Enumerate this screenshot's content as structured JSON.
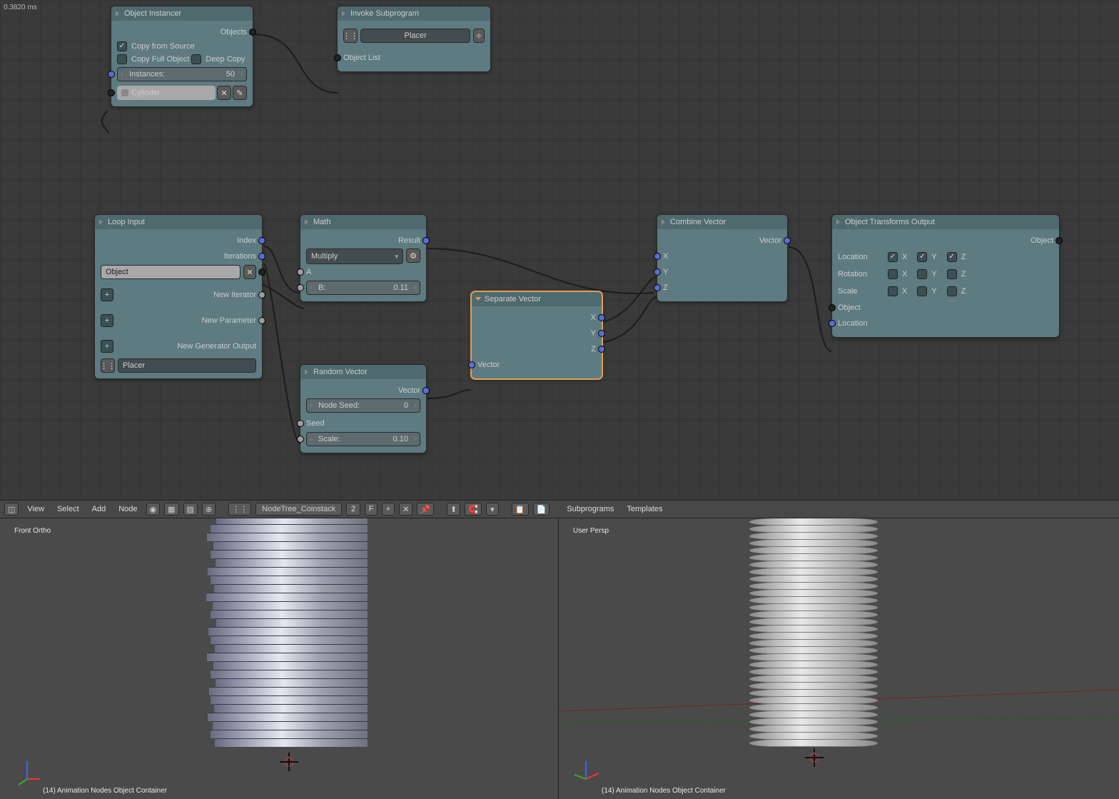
{
  "timing": "0.3820 ms",
  "nodes": {
    "obj_instancer": {
      "title": "Object Instancer",
      "out_objects": "Objects",
      "chk_copy_source": "Copy from Source",
      "chk_copy_full": "Copy Full Object",
      "chk_deep_copy": "Deep Copy",
      "instances_label": "Instances:",
      "instances_val": "50",
      "object_val": "Cylinder"
    },
    "invoke": {
      "title": "Invoke Subprogram",
      "program": "Placer",
      "out_list": "Object List"
    },
    "loop": {
      "title": "Loop Input",
      "index": "Index",
      "iterations": "Iterations",
      "obj_field": "Object",
      "new_iter": "New Iterator",
      "new_param": "New Parameter",
      "new_gen": "New Generator Output",
      "subprog": "Placer"
    },
    "math": {
      "title": "Math",
      "result": "Result",
      "mode": "Multiply",
      "a": "A",
      "b_label": "B:",
      "b_val": "0.11"
    },
    "randvec": {
      "title": "Random Vector",
      "vector": "Vector",
      "seed_label": "Node Seed:",
      "seed_val": "0",
      "seed": "Seed",
      "scale_label": "Scale:",
      "scale_val": "0.10"
    },
    "sepvec": {
      "title": "Separate Vector",
      "x": "X",
      "y": "Y",
      "z": "Z",
      "vector": "Vector"
    },
    "combvec": {
      "title": "Combine Vector",
      "vector": "Vector",
      "x": "X",
      "y": "Y",
      "z": "Z"
    },
    "transout": {
      "title": "Object Transforms Output",
      "object": "Object",
      "loc": "Location",
      "rot": "Rotation",
      "scale": "Scale",
      "x": "X",
      "y": "Y",
      "z": "Z",
      "obj_in": "Object",
      "loc_in": "Location"
    }
  },
  "toolbar": {
    "view": "View",
    "select": "Select",
    "add": "Add",
    "node": "Node",
    "nodetree": "NodeTree_Coinstack",
    "count": "2",
    "fake": "F",
    "subprograms": "Subprograms",
    "templates": "Templates"
  },
  "viewports": {
    "left_label": "Front Ortho",
    "right_label": "User Persp",
    "footer": "(14) Animation Nodes Object Container"
  }
}
